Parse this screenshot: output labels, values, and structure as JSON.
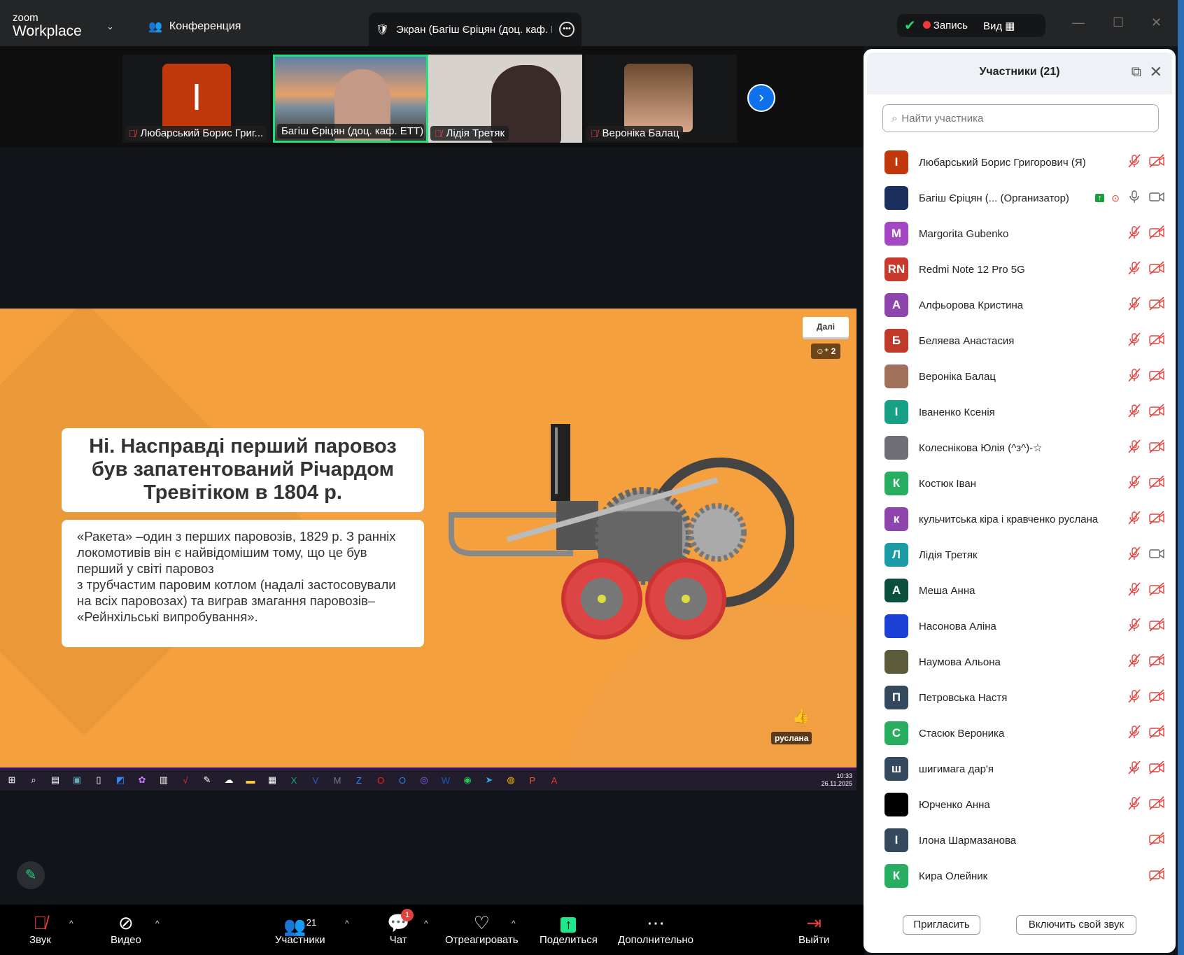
{
  "app": {
    "logo_top": "zoom",
    "logo_bottom": "Workplace",
    "meeting_label": "Конференция",
    "share_tab": "Экран (Багіш Єріцян (доц. каф. ЕТТ)",
    "record": "Запись",
    "view": "Вид"
  },
  "thumbnails": [
    {
      "name": "Любарський Борис Григ...",
      "initial": "І",
      "muted": true
    },
    {
      "name": "Багіш Єріцян (доц. каф. ЕТТ)",
      "muted": false,
      "active": true
    },
    {
      "name": "Лідія Третяк",
      "muted": true
    },
    {
      "name": "Вероніка Балац",
      "muted": true
    }
  ],
  "slide": {
    "title_bold": "Ні.",
    "title_rest": " Насправді перший паровоз був запатентований Річардом Тревітіком в 1804 р.",
    "body": [
      "«Ракета» –один з перших паровозів, 1829 р. З ранніх локомотивів він є найвідомішим тому, що це був перший у світі паровоз",
      "з трубчастим паровим котлом (надалі застосовували на всіх паровозах) та виграв змагання паровозів– «Рейнхільські випробування»."
    ],
    "next_button": "Далі",
    "reaction_count": "2",
    "reaction_user": "руслана"
  },
  "taskbar": {
    "time": "10:33",
    "date": "26.11.2025"
  },
  "toolbar": {
    "audio": "Звук",
    "video": "Видео",
    "participants": "Участники",
    "participants_count": "21",
    "chat": "Чат",
    "chat_badge": "1",
    "react": "Отреагировать",
    "share": "Поделиться",
    "more": "Дополнительно",
    "leave": "Выйти"
  },
  "panel": {
    "title": "Участники (21)",
    "search_placeholder": "Найти участника",
    "invite": "Пригласить",
    "unmute_self": "Включить свой звук",
    "participants": [
      {
        "name": "Любарський Борис Григорович (Я)",
        "initial": "І",
        "color": "#c1380d",
        "mic": "muted",
        "video": "off"
      },
      {
        "name": "Багіш Єріцян (...  (Организатор)",
        "initial": "",
        "color": "#1b2f5e",
        "mic": "on",
        "video": "on",
        "sharing": true
      },
      {
        "name": "Margorita Gubenko",
        "initial": "M",
        "color": "#a547c4",
        "mic": "muted",
        "video": "off"
      },
      {
        "name": "Redmi Note 12 Pro 5G",
        "initial": "RN",
        "color": "#c83a2e",
        "mic": "muted",
        "video": "off"
      },
      {
        "name": "Алфьорова Кристина",
        "initial": "А",
        "color": "#8e44ad",
        "mic": "muted",
        "video": "off"
      },
      {
        "name": "Беляева Анастасия",
        "initial": "Б",
        "color": "#c0392b",
        "mic": "muted",
        "video": "off"
      },
      {
        "name": "Вероніка Балац",
        "initial": "",
        "color": "#a0705a",
        "mic": "muted",
        "video": "off"
      },
      {
        "name": "Іваненко Ксенія",
        "initial": "І",
        "color": "#16a085",
        "mic": "muted",
        "video": "off"
      },
      {
        "name": "Колеснікова Юлія (^з^)-☆",
        "initial": "",
        "color": "#6e6e74",
        "mic": "muted",
        "video": "off"
      },
      {
        "name": "Костюк Іван",
        "initial": "К",
        "color": "#27ae60",
        "mic": "muted",
        "video": "off"
      },
      {
        "name": "кульчитська кіра і кравченко руслана",
        "initial": "к",
        "color": "#8e44ad",
        "mic": "muted",
        "video": "off"
      },
      {
        "name": "Лідія Третяк",
        "initial": "Л",
        "color": "#1a9ba6",
        "mic": "muted",
        "video": "on"
      },
      {
        "name": "Меша Анна",
        "initial": "А",
        "color": "#0b4f3e",
        "mic": "muted",
        "video": "off"
      },
      {
        "name": "Насонова Аліна",
        "initial": "",
        "color": "#1c3fd6",
        "mic": "muted",
        "video": "off"
      },
      {
        "name": "Наумова Альона",
        "initial": "",
        "color": "#5b5a3a",
        "mic": "muted",
        "video": "off"
      },
      {
        "name": "Петровська Настя",
        "initial": "П",
        "color": "#34495e",
        "mic": "muted",
        "video": "off"
      },
      {
        "name": "Стасюк Вероника",
        "initial": "С",
        "color": "#27ae60",
        "mic": "muted",
        "video": "off"
      },
      {
        "name": "шигимага дар'я",
        "initial": "ш",
        "color": "#34495e",
        "mic": "muted",
        "video": "off"
      },
      {
        "name": "Юрченко Анна",
        "initial": "",
        "color": "#000000",
        "mic": "muted",
        "video": "off"
      },
      {
        "name": "Ілона Шармазанова",
        "initial": "І",
        "color": "#34495e",
        "mic": "none",
        "video": "off"
      },
      {
        "name": "Кира Олейник",
        "initial": "К",
        "color": "#27ae60",
        "mic": "none",
        "video": "off"
      }
    ]
  }
}
